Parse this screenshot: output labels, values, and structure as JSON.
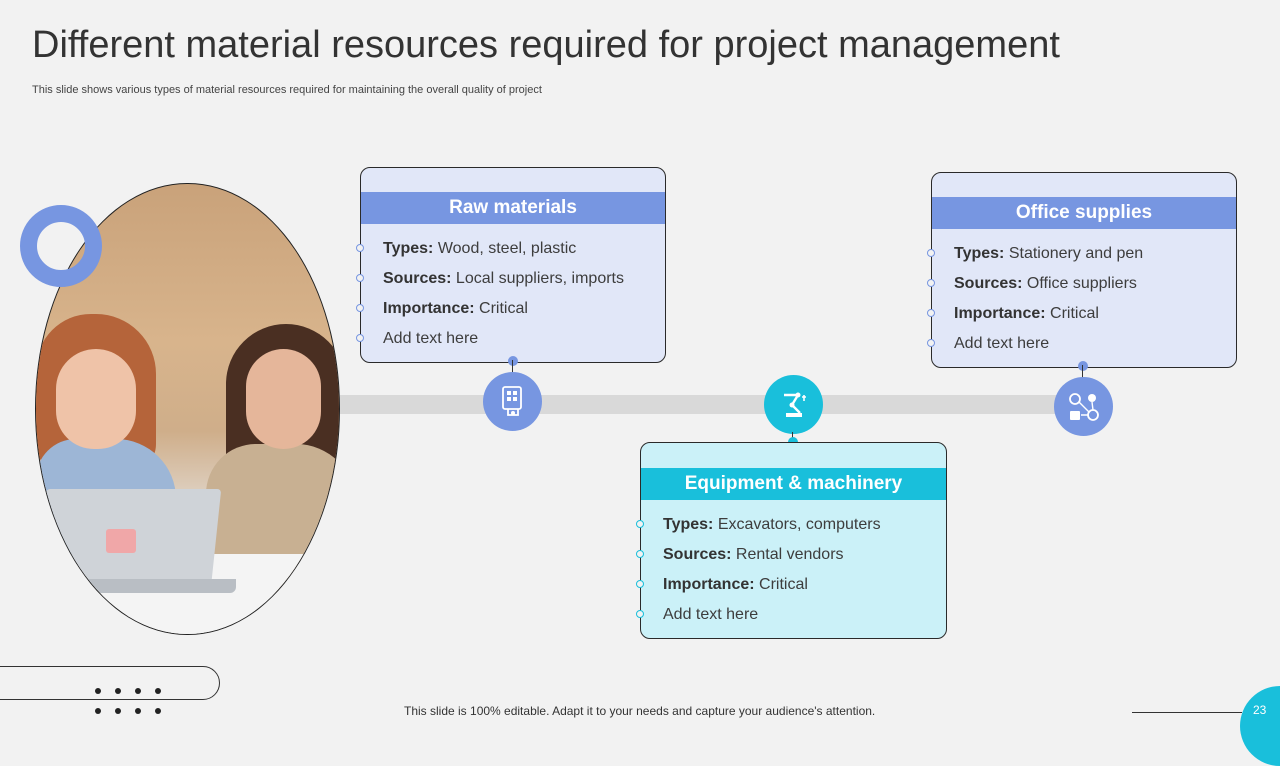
{
  "slide": {
    "title": "Different material resources required for project management",
    "subtitle": "This slide shows various types of material resources required for maintaining the overall quality of project",
    "footer": "This slide is 100% editable. Adapt it to your needs and capture your audience's attention.",
    "page_number": "23"
  },
  "cards": {
    "raw": {
      "heading": "Raw materials",
      "items": [
        {
          "label": "Types:",
          "text": " Wood, steel, plastic"
        },
        {
          "label": "Sources:",
          "text": " Local suppliers, imports"
        },
        {
          "label": "Importance:",
          "text": " Critical"
        },
        {
          "label": "",
          "text": "Add text here"
        }
      ]
    },
    "equipment": {
      "heading": "Equipment & machinery",
      "items": [
        {
          "label": "Types:",
          "text": " Excavators, computers"
        },
        {
          "label": "Sources:",
          "text": " Rental vendors"
        },
        {
          "label": "Importance:",
          "text": " Critical"
        },
        {
          "label": "",
          "text": "Add text here"
        }
      ]
    },
    "office": {
      "heading": "Office supplies",
      "items": [
        {
          "label": "Types:",
          "text": " Stationery and pen"
        },
        {
          "label": "Sources:",
          "text": " Office suppliers"
        },
        {
          "label": "Importance:",
          "text": " Critical"
        },
        {
          "label": "",
          "text": "Add text here"
        }
      ]
    }
  },
  "icons": {
    "raw": "raw-materials-icon",
    "equipment": "robotic-arm-icon",
    "office": "office-supplies-icon"
  },
  "colors": {
    "blue_accent": "#7796e1",
    "cyan_accent": "#19bfdb",
    "blue_card_bg": "#e1e7f8",
    "cyan_card_bg": "#cbf1f8",
    "background": "#f2f2f2"
  }
}
